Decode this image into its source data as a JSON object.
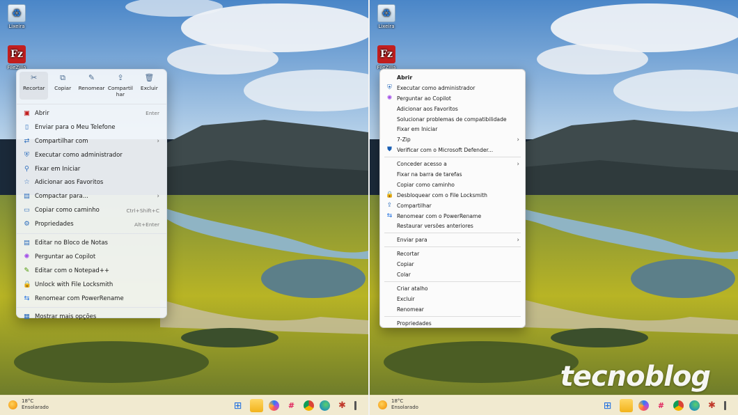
{
  "desktop": {
    "recycle_bin_label": "Lixeira",
    "filezilla_label": "FileZilla"
  },
  "modern_menu": {
    "quick_actions": [
      {
        "label": "Recortar",
        "icon": "scissors-icon"
      },
      {
        "label": "Copiar",
        "icon": "copy-icon"
      },
      {
        "label": "Renomear",
        "icon": "rename-icon"
      },
      {
        "label": "Compartil har",
        "icon": "share-icon"
      },
      {
        "label": "Excluir",
        "icon": "trash-icon"
      }
    ],
    "items": [
      {
        "label": "Abrir",
        "shortcut": "Enter",
        "icon": "filezilla-icon",
        "submenu": false
      },
      {
        "label": "Enviar para o Meu Telefone",
        "shortcut": "",
        "icon": "phone-icon",
        "submenu": false
      },
      {
        "label": "Compartilhar com",
        "shortcut": "",
        "icon": "share-with-icon",
        "submenu": true
      },
      {
        "label": "Executar como administrador",
        "shortcut": "",
        "icon": "shield-icon",
        "submenu": false
      },
      {
        "label": "Fixar em Iniciar",
        "shortcut": "",
        "icon": "pin-icon",
        "submenu": false
      },
      {
        "label": "Adicionar aos Favoritos",
        "shortcut": "",
        "icon": "star-icon",
        "submenu": false
      },
      {
        "label": "Compactar para...",
        "shortcut": "",
        "icon": "zip-icon",
        "submenu": true
      },
      {
        "label": "Copiar como caminho",
        "shortcut": "Ctrl+Shift+C",
        "icon": "path-icon",
        "submenu": false
      },
      {
        "label": "Propriedades",
        "shortcut": "Alt+Enter",
        "icon": "wrench-icon",
        "submenu": false
      },
      {
        "label": "Editar no Bloco de Notas",
        "shortcut": "",
        "icon": "notepad-icon",
        "submenu": false
      },
      {
        "label": "Perguntar ao Copilot",
        "shortcut": "",
        "icon": "copilot-icon",
        "submenu": false
      },
      {
        "label": "Editar com o Notepad++",
        "shortcut": "",
        "icon": "notepadpp-icon",
        "submenu": false
      },
      {
        "label": "Unlock with File Locksmith",
        "shortcut": "",
        "icon": "lock-icon",
        "submenu": false
      },
      {
        "label": "Renomear com PowerRename",
        "shortcut": "",
        "icon": "powerrename-icon",
        "submenu": false
      },
      {
        "label": "Mostrar mais opções",
        "shortcut": "",
        "icon": "more-options-icon",
        "submenu": false
      }
    ]
  },
  "classic_menu": {
    "groups": [
      [
        {
          "label": "Abrir",
          "icon": "",
          "submenu": false,
          "bold": true
        },
        {
          "label": "Executar como administrador",
          "icon": "shield-icon",
          "submenu": false
        },
        {
          "label": "Perguntar ao Copilot",
          "icon": "copilot-icon",
          "submenu": false
        },
        {
          "label": "Adicionar aos Favoritos",
          "icon": "",
          "submenu": false
        },
        {
          "label": "Solucionar problemas de compatibilidade",
          "icon": "",
          "submenu": false
        },
        {
          "label": "Fixar em Iniciar",
          "icon": "",
          "submenu": false
        },
        {
          "label": "7-Zip",
          "icon": "",
          "submenu": true
        },
        {
          "label": "Verificar com o Microsoft Defender...",
          "icon": "defender-icon",
          "submenu": false
        }
      ],
      [
        {
          "label": "Conceder acesso a",
          "icon": "",
          "submenu": true
        },
        {
          "label": "Fixar na barra de tarefas",
          "icon": "",
          "submenu": false
        },
        {
          "label": "Copiar como caminho",
          "icon": "",
          "submenu": false
        },
        {
          "label": "Desbloquear com o File Locksmith",
          "icon": "lock-icon",
          "submenu": false
        },
        {
          "label": "Compartilhar",
          "icon": "share-icon",
          "submenu": false
        },
        {
          "label": "Renomear com o PowerRename",
          "icon": "powerrename-icon",
          "submenu": false
        },
        {
          "label": "Restaurar versões anteriores",
          "icon": "",
          "submenu": false
        }
      ],
      [
        {
          "label": "Enviar para",
          "icon": "",
          "submenu": true
        }
      ],
      [
        {
          "label": "Recortar",
          "icon": "",
          "submenu": false
        },
        {
          "label": "Copiar",
          "icon": "",
          "submenu": false
        },
        {
          "label": "Colar",
          "icon": "",
          "submenu": false
        }
      ],
      [
        {
          "label": "Criar atalho",
          "icon": "",
          "submenu": false
        },
        {
          "label": "Excluir",
          "icon": "",
          "submenu": false
        },
        {
          "label": "Renomear",
          "icon": "",
          "submenu": false
        }
      ],
      [
        {
          "label": "Propriedades",
          "icon": "",
          "submenu": false
        }
      ]
    ]
  },
  "taskbar": {
    "temperature": "18°C",
    "condition": "Ensolarado",
    "apps": [
      "windows-start-icon",
      "file-explorer-icon",
      "copilot-icon",
      "slack-icon",
      "chrome-icon",
      "edge-icon",
      "puzzle-app-icon",
      "pinned-app-icon"
    ]
  },
  "watermark": "tecnoblog"
}
